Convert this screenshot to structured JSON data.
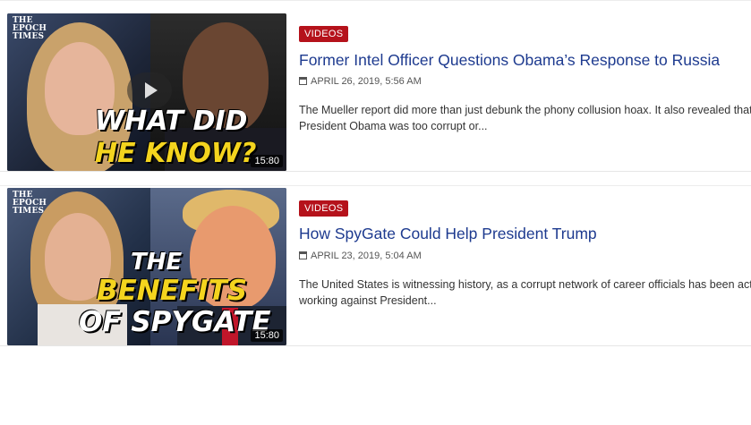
{
  "articles": [
    {
      "category": "VIDEOS",
      "title": "Former Intel Officer Questions Obama’s Response to Russia",
      "date": "APRIL 26, 2019, 5:56 AM",
      "excerpt_line1": "The Mueller report did more than just debunk the phony collusion hoax. It also revealed that",
      "excerpt_line2": "President Obama was too corrupt or...",
      "thumbnail": {
        "logo_line1": "THE",
        "logo_line2": "EPOCH",
        "logo_line3": "TIMES",
        "headline_line1": "WHAT DID",
        "headline_line2": "HE KNOW?",
        "duration": "15:80"
      }
    },
    {
      "category": "VIDEOS",
      "title": "How SpyGate Could Help President Trump",
      "date": "APRIL 23, 2019, 5:04 AM",
      "excerpt_line1": "The United States is witnessing history, as a corrupt network of career officials has been active",
      "excerpt_line2": "working against President...",
      "thumbnail": {
        "logo_line1": "THE",
        "logo_line2": "EPOCH",
        "logo_line3": "TIMES",
        "headline_line1": "THE",
        "headline_line2": "BENEFITS",
        "headline_line3": "OF SPYGATE",
        "duration": "15:80"
      }
    }
  ],
  "colors": {
    "badge": "#b5121b",
    "title_link": "#1d3a8f",
    "headline_yellow": "#f4d41e"
  }
}
